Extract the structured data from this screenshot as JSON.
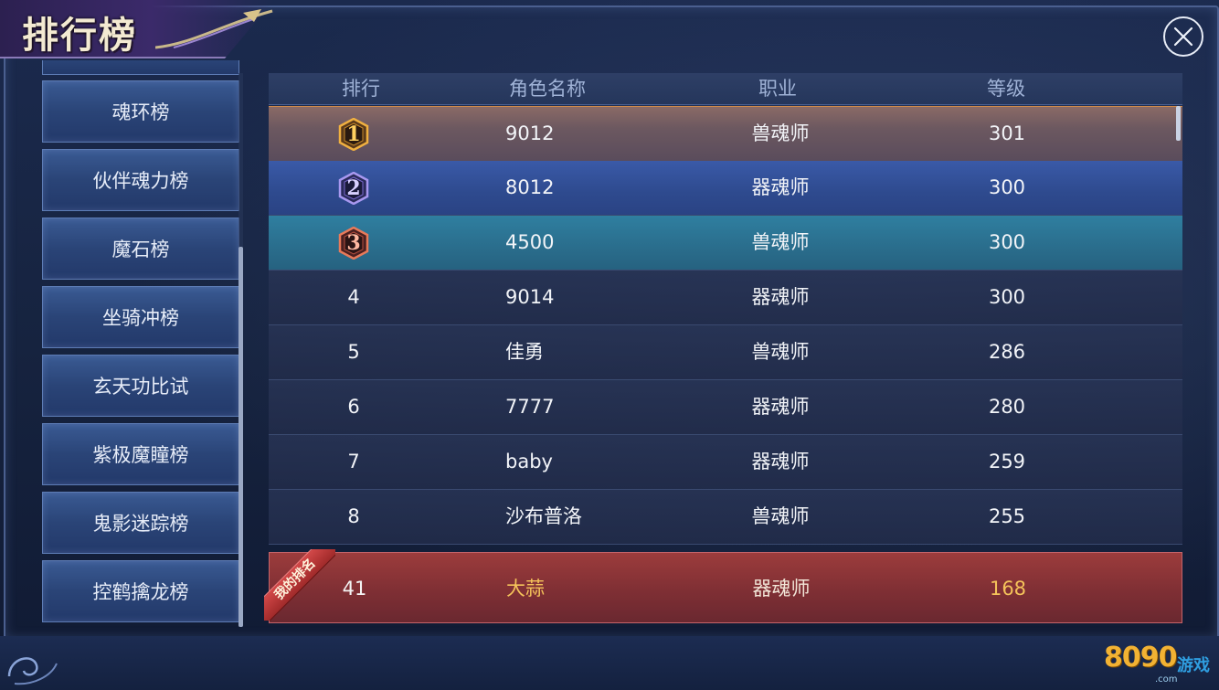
{
  "title": "排行榜",
  "sidebar": {
    "items": [
      {
        "label": "魂环榜"
      },
      {
        "label": "伙伴魂力榜"
      },
      {
        "label": "魔石榜"
      },
      {
        "label": "坐骑冲榜"
      },
      {
        "label": "玄天功比试"
      },
      {
        "label": "紫极魔瞳榜"
      },
      {
        "label": "鬼影迷踪榜"
      },
      {
        "label": "控鹤擒龙榜"
      }
    ]
  },
  "table": {
    "headers": {
      "rank": "排行",
      "name": "角色名称",
      "job": "职业",
      "level": "等级"
    },
    "rows": [
      {
        "rank": "1",
        "name": "9012",
        "job": "兽魂师",
        "level": "301"
      },
      {
        "rank": "2",
        "name": "8012",
        "job": "器魂师",
        "level": "300"
      },
      {
        "rank": "3",
        "name": "4500",
        "job": "兽魂师",
        "level": "300"
      },
      {
        "rank": "4",
        "name": "9014",
        "job": "器魂师",
        "level": "300"
      },
      {
        "rank": "5",
        "name": "佳勇",
        "job": "兽魂师",
        "level": "286"
      },
      {
        "rank": "6",
        "name": "7777",
        "job": "器魂师",
        "level": "280"
      },
      {
        "rank": "7",
        "name": "baby",
        "job": "器魂师",
        "level": "259"
      },
      {
        "rank": "8",
        "name": "沙布普洛",
        "job": "兽魂师",
        "level": "255"
      }
    ]
  },
  "my_rank": {
    "ribbon": "我的排名",
    "rank": "41",
    "name": "大蒜",
    "job": "器魂师",
    "level": "168"
  },
  "logo": {
    "number": "8090",
    "text": "游戏",
    "domain": ".com"
  },
  "colors": {
    "gold": "#f4c25a",
    "rank1_badge": "#e0a030",
    "rank2_badge": "#8a7ae0",
    "rank3_badge": "#e05a4a"
  }
}
